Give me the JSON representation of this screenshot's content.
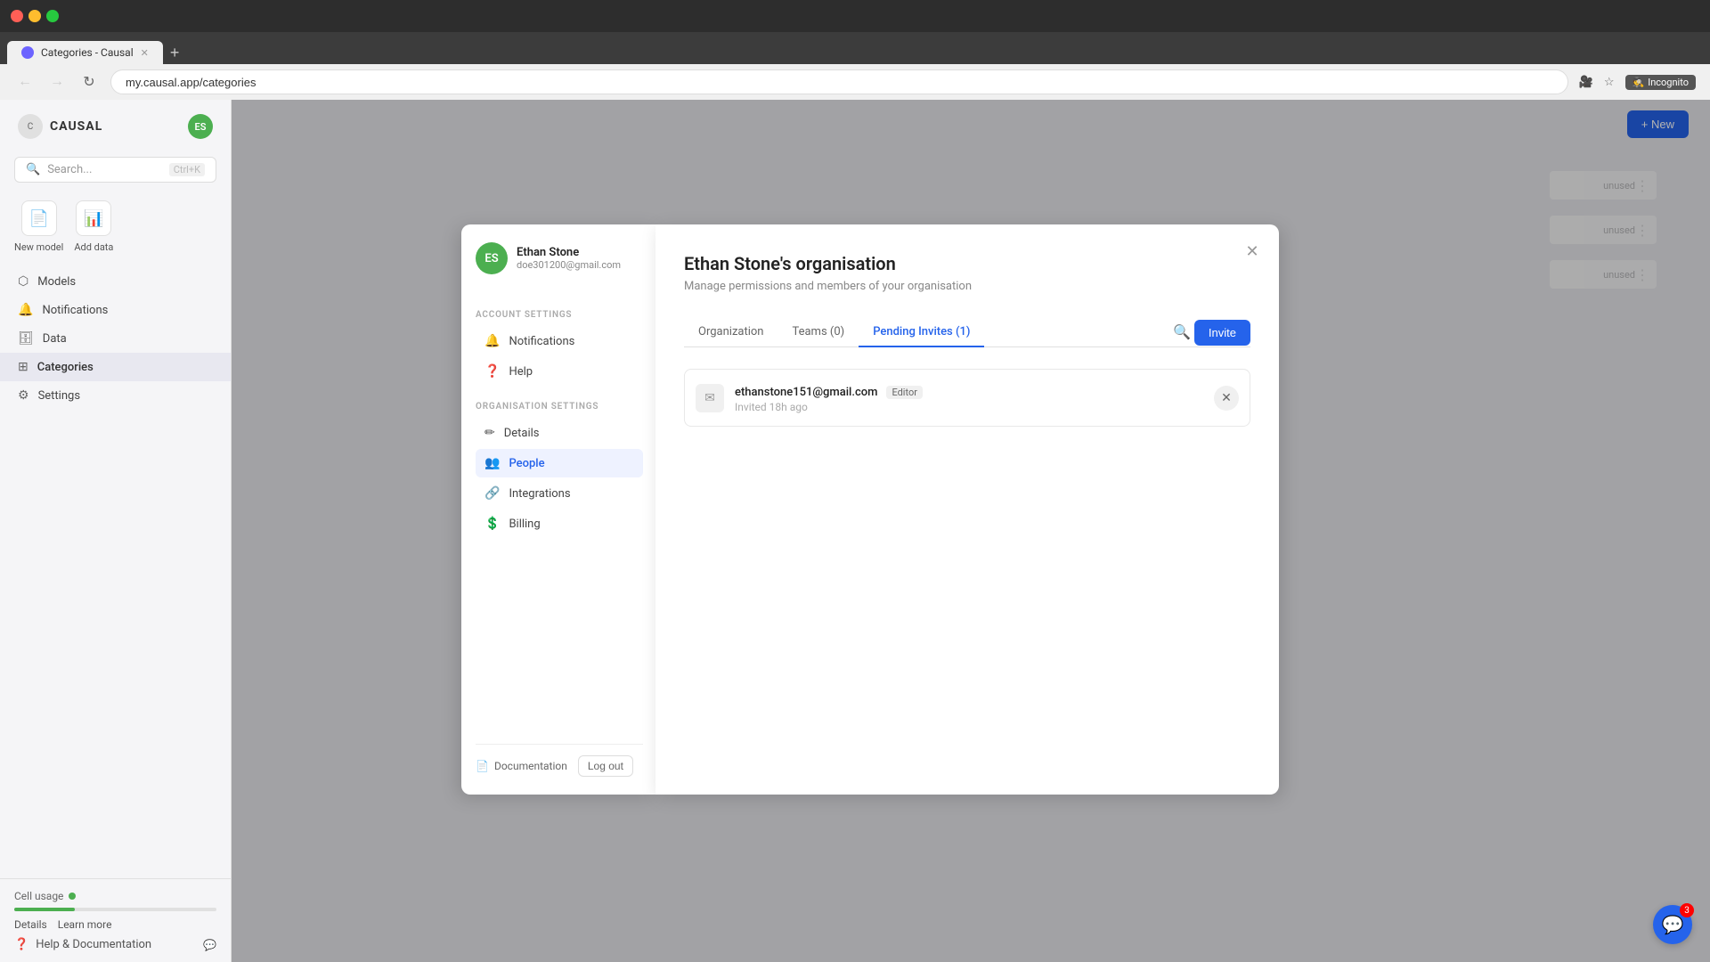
{
  "browser": {
    "tab_title": "Categories - Causal",
    "url": "my.causal.app/categories",
    "incognito_label": "Incognito",
    "new_tab_symbol": "+"
  },
  "sidebar": {
    "logo": "CAUSAL",
    "avatar_initials": "ES",
    "search_placeholder": "Search...",
    "search_shortcut": "Ctrl+K",
    "quick_actions": [
      {
        "id": "new-model",
        "label": "New model",
        "icon": "📄"
      },
      {
        "id": "add-data",
        "label": "Add data",
        "icon": "📊"
      }
    ],
    "nav_items": [
      {
        "id": "models",
        "label": "Models",
        "icon": "⬡"
      },
      {
        "id": "notifications",
        "label": "Notifications",
        "icon": "🔔"
      },
      {
        "id": "data",
        "label": "Data",
        "icon": "🗄"
      },
      {
        "id": "categories",
        "label": "Categories",
        "icon": "⊞",
        "active": true
      },
      {
        "id": "settings",
        "label": "Settings",
        "icon": "⚙"
      }
    ],
    "cell_usage_label": "Cell usage",
    "usage_details": "Details",
    "usage_learn_more": "Learn more",
    "help_label": "Help & Documentation"
  },
  "account_panel": {
    "user_name": "Ethan Stone",
    "user_email": "doe301200@gmail.com",
    "avatar_initials": "ES",
    "account_settings_label": "ACCOUNT SETTINGS",
    "account_settings_items": [
      {
        "id": "notifications",
        "label": "Notifications",
        "icon": "🔔"
      },
      {
        "id": "help",
        "label": "Help",
        "icon": "?"
      }
    ],
    "org_settings_label": "ORGANISATION SETTINGS",
    "org_settings_items": [
      {
        "id": "details",
        "label": "Details",
        "icon": "✏"
      },
      {
        "id": "people",
        "label": "People",
        "icon": "👥",
        "active": true
      },
      {
        "id": "integrations",
        "label": "Integrations",
        "icon": "🔗"
      },
      {
        "id": "billing",
        "label": "Billing",
        "icon": "$"
      }
    ],
    "documentation_label": "Documentation",
    "logout_label": "Log out"
  },
  "modal": {
    "title": "Ethan Stone's organisation",
    "subtitle": "Manage permissions and members of your organisation",
    "tabs": [
      {
        "id": "organization",
        "label": "Organization"
      },
      {
        "id": "teams",
        "label": "Teams (0)"
      },
      {
        "id": "pending-invites",
        "label": "Pending Invites (1)",
        "active": true
      }
    ],
    "invite_button_label": "Invite",
    "pending_invite": {
      "email": "ethanstone151@gmail.com",
      "role": "Editor",
      "time": "Invited 18h ago"
    }
  },
  "chat": {
    "badge_count": "3"
  },
  "new_button": "+ New"
}
